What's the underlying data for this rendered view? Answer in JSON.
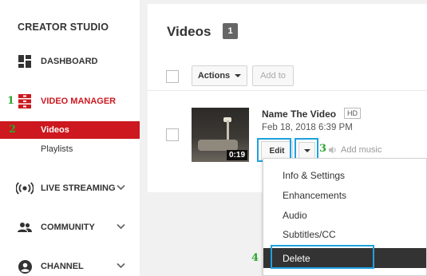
{
  "sidebar": {
    "title": "CREATOR STUDIO",
    "dashboard_label": "DASHBOARD",
    "video_manager_label": "VIDEO MANAGER",
    "videos_label": "Videos",
    "playlists_label": "Playlists",
    "live_streaming_label": "LIVE STREAMING",
    "community_label": "COMMUNITY",
    "channel_label": "CHANNEL"
  },
  "main": {
    "title": "Videos",
    "count": "1",
    "actions_label": "Actions",
    "add_to_label": "Add to"
  },
  "video": {
    "title": "Name The Video",
    "hd": "HD",
    "date": "Feb 18, 2018 6:39 PM",
    "duration": "0:19",
    "edit_label": "Edit",
    "add_music_label": "Add music"
  },
  "menu": {
    "items": [
      "Info & Settings",
      "Enhancements",
      "Audio",
      "Subtitles/CC",
      "Delete"
    ]
  },
  "steps": [
    "1",
    "2",
    "3",
    "4"
  ],
  "colors": {
    "accent": "#cc181e",
    "highlight": "#1ea1e0",
    "step_marker": "#2ea52e"
  }
}
